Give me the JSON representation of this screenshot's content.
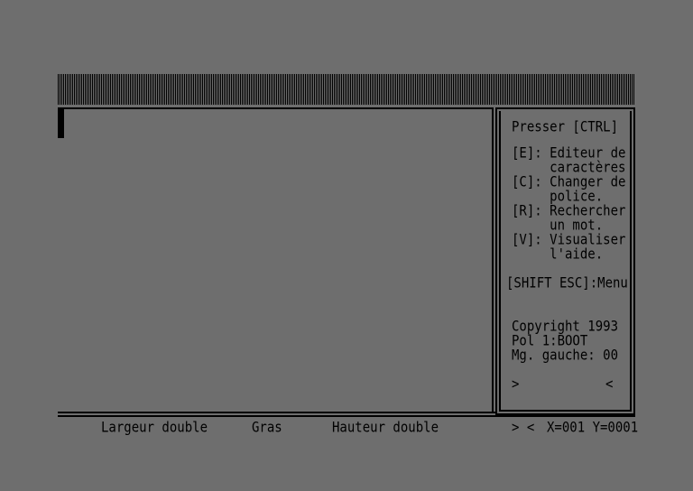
{
  "help_panel": {
    "header": "Presser [CTRL]",
    "lines": [
      "[E]: Editeur de",
      "     caractères",
      "[C]: Changer de",
      "     police.",
      "[R]: Rechercher",
      "     un mot.",
      "[V]: Visualiser",
      "     l'aide."
    ],
    "menu_shortcut": "[SHIFT ESC]:Menu",
    "copyright": "Copyright 1993",
    "font_slot": "Pol 1:BOOT",
    "left_margin": "Mg. gauche: 00",
    "margin_left_marker": ">",
    "margin_right_marker": "<"
  },
  "status_bar": {
    "double_width": "Largeur double",
    "bold": "Gras",
    "double_height": "Hauteur double",
    "margin_markers": "> <",
    "coordinates": "X=001 Y=0001"
  }
}
